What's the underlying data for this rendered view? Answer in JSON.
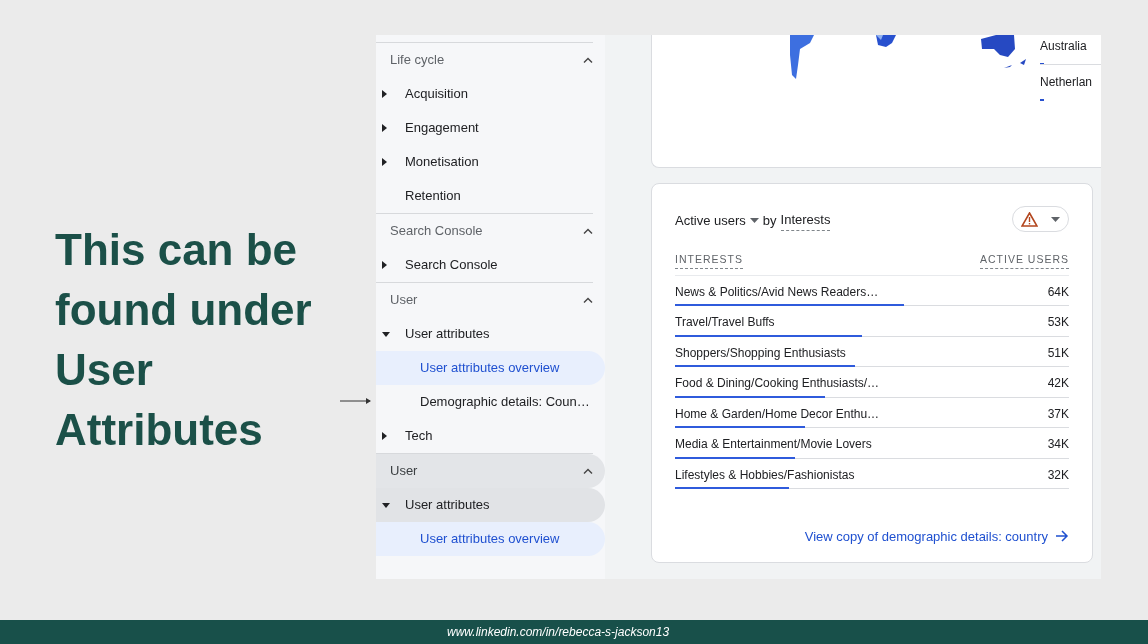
{
  "slide": {
    "heading": "This can be found under User Attributes",
    "footer": "www.linkedin.com/in/rebecca-s-jackson13"
  },
  "sidebar": {
    "sections": [
      {
        "title": "Life cycle",
        "expanded": true,
        "hovered": false,
        "items": [
          {
            "label": "Acquisition",
            "kind": "group",
            "expanded": false,
            "hovered": false
          },
          {
            "label": "Engagement",
            "kind": "group",
            "expanded": false,
            "hovered": false
          },
          {
            "label": "Monetisation",
            "kind": "group",
            "expanded": false,
            "hovered": false
          },
          {
            "label": "Retention",
            "kind": "link",
            "expanded": false,
            "hovered": false
          }
        ]
      },
      {
        "title": "Search Console",
        "expanded": true,
        "hovered": false,
        "items": [
          {
            "label": "Search Console",
            "kind": "group",
            "expanded": false,
            "hovered": false
          }
        ]
      },
      {
        "title": "User",
        "expanded": true,
        "hovered": false,
        "items": [
          {
            "label": "User attributes",
            "kind": "group",
            "expanded": true,
            "hovered": false,
            "children": [
              {
                "label": "User attributes overview",
                "selected": true
              },
              {
                "label": "Demographic details: Coun…",
                "selected": false
              }
            ]
          },
          {
            "label": "Tech",
            "kind": "group",
            "expanded": false,
            "hovered": false
          }
        ]
      },
      {
        "title": "User",
        "expanded": true,
        "hovered": true,
        "items": [
          {
            "label": "User attributes",
            "kind": "group",
            "expanded": true,
            "hovered": true,
            "children": [
              {
                "label": "User attributes overview",
                "selected": true
              }
            ]
          }
        ]
      }
    ]
  },
  "map_card": {
    "legend": [
      {
        "label": "Australia"
      },
      {
        "label": "Netherlan"
      }
    ]
  },
  "interests_card": {
    "metric": "Active users",
    "by": "by",
    "dimension": "Interests",
    "columns": [
      "INTERESTS",
      "ACTIVE USERS"
    ],
    "rows": [
      {
        "name": "News & Politics/Avid News Readers…",
        "value": "64K",
        "level": 0.58
      },
      {
        "name": "Travel/Travel Buffs",
        "value": "53K",
        "level": 0.475
      },
      {
        "name": "Shoppers/Shopping Enthusiasts",
        "value": "51K",
        "level": 0.457
      },
      {
        "name": "Food & Dining/Cooking Enthusiasts/…",
        "value": "42K",
        "level": 0.38
      },
      {
        "name": "Home & Garden/Home Decor Enthu…",
        "value": "37K",
        "level": 0.33
      },
      {
        "name": "Media & Entertainment/Movie Lovers",
        "value": "34K",
        "level": 0.305
      },
      {
        "name": "Lifestyles & Hobbies/Fashionistas",
        "value": "32K",
        "level": 0.29
      }
    ],
    "link": "View copy of demographic details: country"
  }
}
